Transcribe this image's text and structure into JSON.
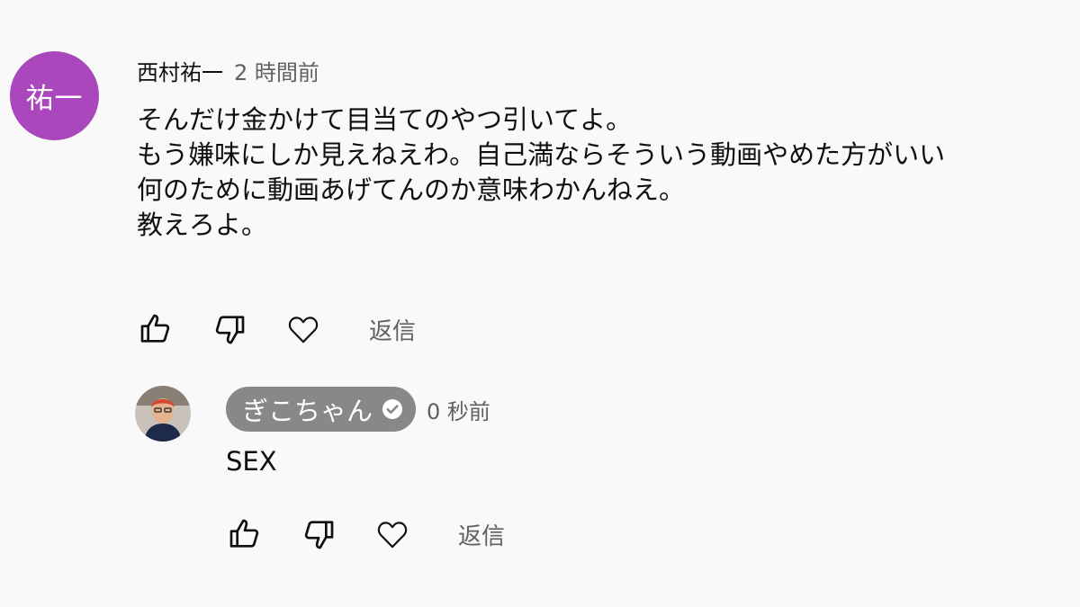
{
  "comment": {
    "avatar_text": "祐一",
    "avatar_color": "#ab47bc",
    "author": "西村祐一",
    "time": "2 時間前",
    "lines": [
      "そんだけ金かけて目当てのやつ引いてよ。",
      "もう嫌味にしか見えねえわ。自己満ならそういう動画やめた方がいい",
      "何のために動画あげてんのか意味わかんねえ。",
      "教えろよ。"
    ],
    "reply_label": "返信"
  },
  "reply": {
    "author": "ぎこちゃん",
    "verified": true,
    "chip_color": "#888888",
    "time": "0 秒前",
    "text": "SEX",
    "reply_label": "返信"
  },
  "icons": {
    "like": "thumbs-up-icon",
    "dislike": "thumbs-down-icon",
    "heart": "heart-icon"
  }
}
